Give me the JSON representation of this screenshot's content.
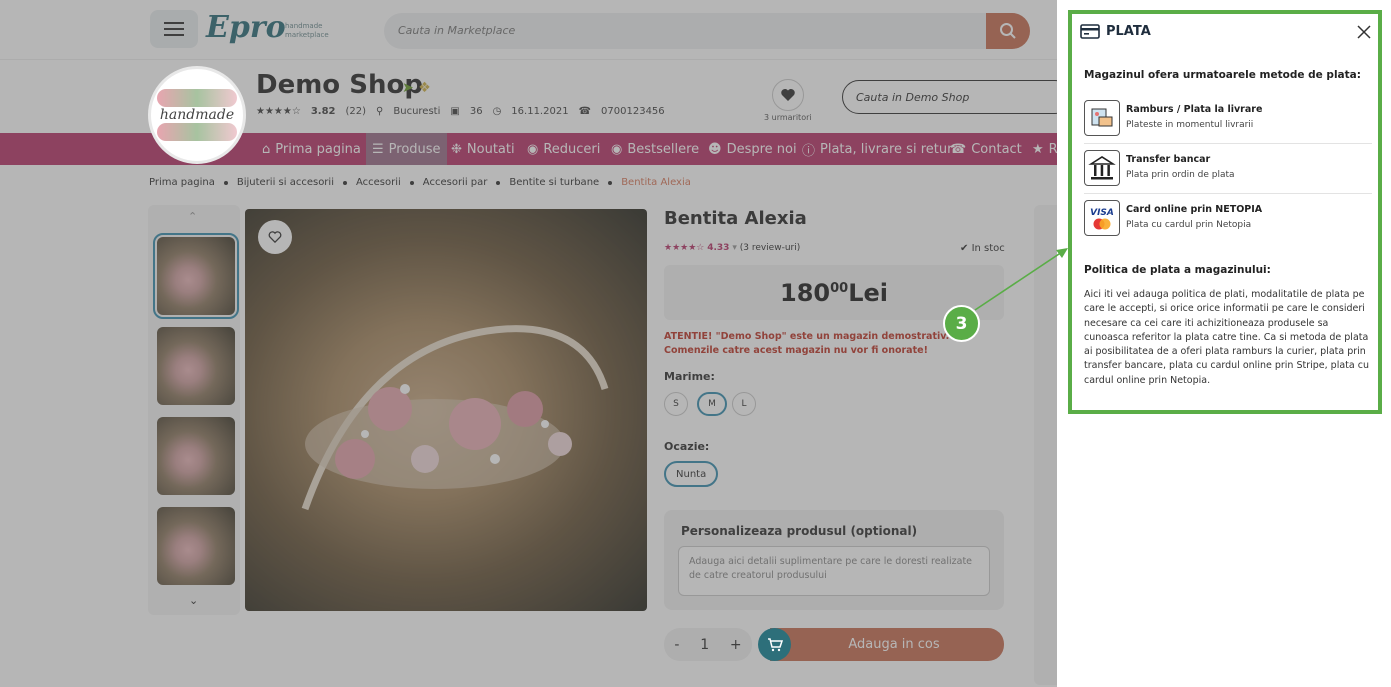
{
  "topbar": {
    "logo_text": "Epro",
    "logo_tagline": "handmade marketplace",
    "search_placeholder": "Cauta in Marketplace"
  },
  "shop": {
    "name": "Demo Shop",
    "logo_text": "handmade",
    "rating": "3.82",
    "reviews": "(22)",
    "city": "Bucuresti",
    "products": "36",
    "since": "16.11.2021",
    "phone": "0700123456",
    "followers": "3 urmaritori",
    "search_placeholder": "Cauta in Demo Shop"
  },
  "nav": {
    "items": [
      {
        "label": "Prima pagina",
        "icon": "home-icon"
      },
      {
        "label": "Produse",
        "icon": "menu-icon"
      },
      {
        "label": "Noutati",
        "icon": "gear-icon"
      },
      {
        "label": "Reduceri",
        "icon": "percent-icon"
      },
      {
        "label": "Bestsellere",
        "icon": "eye-icon"
      },
      {
        "label": "Despre noi",
        "icon": "user-icon"
      },
      {
        "label": "Plata, livrare si retur",
        "icon": "info-icon"
      },
      {
        "label": "Contact",
        "icon": "phone-icon"
      },
      {
        "label": "R",
        "icon": "star-icon"
      }
    ]
  },
  "breadcrumb": [
    "Prima pagina",
    "Bijuterii si accesorii",
    "Accesorii",
    "Accesorii par",
    "Bentite si turbane",
    "Bentita Alexia"
  ],
  "product": {
    "title": "Bentita Alexia",
    "rating": "4.33",
    "reviews": "(3 review-uri)",
    "stock": "In stoc",
    "price_main": "180",
    "price_cents": "00",
    "currency": "Lei",
    "warning": "ATENTIE! \"Demo Shop\" este un magazin demostrativ. Comenzile catre acest magazin nu vor fi onorate!",
    "size_label": "Marime:",
    "sizes": [
      "S",
      "M",
      "L"
    ],
    "selected_size": "M",
    "occasion_label": "Ocazie:",
    "occasion": "Nunta",
    "personalize_title": "Personalizeaza produsul (optional)",
    "personalize_placeholder": "Adauga aici detalii suplimentare pe care le doresti realizate de catre creatorul produsului",
    "quantity": "1",
    "qty_minus": "-",
    "qty_plus": "+",
    "add_to_cart": "Adauga in cos"
  },
  "modal": {
    "title": "PLATA",
    "methods_heading": "Magazinul ofera urmatoarele metode de plata:",
    "methods": [
      {
        "name": "Ramburs / Plata la livrare",
        "desc": "Plateste in momentul livrarii",
        "icon": "cash-on-delivery-icon"
      },
      {
        "name": "Transfer bancar",
        "desc": "Plata prin ordin de plata",
        "icon": "bank-icon"
      },
      {
        "name": "Card online prin NETOPIA",
        "desc": "Plata cu cardul prin Netopia",
        "icon": "card-visa-mastercard-icon"
      }
    ],
    "policy_heading": "Politica de plata a magazinului:",
    "policy_text": "Aici iti vei adauga politica de plati, modalitatile de plata pe care le accepti, si orice orice informatii pe care le consideri necesare ca cei care iti achizitioneaza produsele sa cunoasca referitor la plata catre tine. Ca si metoda de plata ai posibilitatea de a oferi plata ramburs la curier, plata prin transfer bancare, plata cu cardul online prin Stripe, plata cu cardul online prin Netopia."
  },
  "annotation": {
    "number": "3"
  },
  "colors": {
    "nav_bg": "#b8376b",
    "accent_teal": "#2d6f7a",
    "cart_button": "#c87055",
    "annotation_green": "#5aad47",
    "warning_red": "#c0392b"
  }
}
